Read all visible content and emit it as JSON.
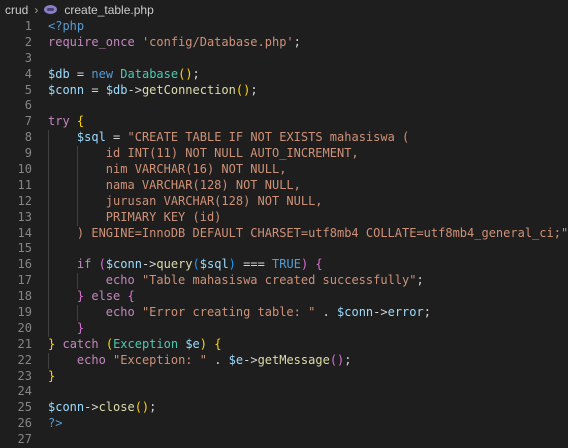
{
  "breadcrumb": {
    "folder": "crud",
    "file": "create_table.php"
  },
  "lines": [
    {
      "n": "1",
      "tokens": [
        [
          "tag",
          "<?php"
        ]
      ]
    },
    {
      "n": "2",
      "tokens": [
        [
          "kw",
          "require_once"
        ],
        [
          "plain",
          " "
        ],
        [
          "str",
          "'config/Database.php'"
        ],
        [
          "plain",
          ";"
        ]
      ]
    },
    {
      "n": "3",
      "tokens": []
    },
    {
      "n": "4",
      "tokens": [
        [
          "var",
          "$db"
        ],
        [
          "plain",
          " = "
        ],
        [
          "sqlkw",
          "new"
        ],
        [
          "plain",
          " "
        ],
        [
          "cls",
          "Database"
        ],
        [
          "p1",
          "()"
        ],
        [
          "plain",
          ";"
        ]
      ]
    },
    {
      "n": "5",
      "tokens": [
        [
          "var",
          "$conn"
        ],
        [
          "plain",
          " = "
        ],
        [
          "var",
          "$db"
        ],
        [
          "plain",
          "->"
        ],
        [
          "fn",
          "getConnection"
        ],
        [
          "p1",
          "()"
        ],
        [
          "plain",
          ";"
        ]
      ]
    },
    {
      "n": "6",
      "tokens": []
    },
    {
      "n": "7",
      "tokens": [
        [
          "kw",
          "try"
        ],
        [
          "plain",
          " "
        ],
        [
          "p1",
          "{"
        ]
      ]
    },
    {
      "n": "8",
      "tokens": [
        [
          "plain",
          "    "
        ],
        [
          "var",
          "$sql"
        ],
        [
          "plain",
          " = "
        ],
        [
          "str",
          "\"CREATE TABLE IF NOT EXISTS mahasiswa ("
        ]
      ]
    },
    {
      "n": "9",
      "tokens": [
        [
          "str",
          "        id INT(11) NOT NULL AUTO_INCREMENT,"
        ]
      ]
    },
    {
      "n": "10",
      "tokens": [
        [
          "str",
          "        nim VARCHAR(16) NOT NULL,"
        ]
      ]
    },
    {
      "n": "11",
      "tokens": [
        [
          "str",
          "        nama VARCHAR(128) NOT NULL,"
        ]
      ]
    },
    {
      "n": "12",
      "tokens": [
        [
          "str",
          "        jurusan VARCHAR(128) NOT NULL,"
        ]
      ]
    },
    {
      "n": "13",
      "tokens": [
        [
          "str",
          "        PRIMARY KEY (id)"
        ]
      ]
    },
    {
      "n": "14",
      "tokens": [
        [
          "str",
          "    ) ENGINE=InnoDB DEFAULT CHARSET=utf8mb4 COLLATE=utf8mb4_general_ci;\""
        ],
        [
          "plain",
          ";"
        ]
      ]
    },
    {
      "n": "15",
      "tokens": []
    },
    {
      "n": "16",
      "tokens": [
        [
          "plain",
          "    "
        ],
        [
          "kw",
          "if"
        ],
        [
          "plain",
          " "
        ],
        [
          "p2",
          "("
        ],
        [
          "var",
          "$conn"
        ],
        [
          "plain",
          "->"
        ],
        [
          "fn",
          "query"
        ],
        [
          "p3",
          "("
        ],
        [
          "var",
          "$sql"
        ],
        [
          "p3",
          ")"
        ],
        [
          "plain",
          " === "
        ],
        [
          "sqlkw",
          "TRUE"
        ],
        [
          "p2",
          ")"
        ],
        [
          "plain",
          " "
        ],
        [
          "p2",
          "{"
        ]
      ]
    },
    {
      "n": "17",
      "tokens": [
        [
          "plain",
          "        "
        ],
        [
          "kw",
          "echo"
        ],
        [
          "plain",
          " "
        ],
        [
          "str",
          "\"Table mahasiswa created successfully\""
        ],
        [
          "plain",
          ";"
        ]
      ]
    },
    {
      "n": "18",
      "tokens": [
        [
          "plain",
          "    "
        ],
        [
          "p2",
          "}"
        ],
        [
          "plain",
          " "
        ],
        [
          "kw",
          "else"
        ],
        [
          "plain",
          " "
        ],
        [
          "p2",
          "{"
        ]
      ]
    },
    {
      "n": "19",
      "tokens": [
        [
          "plain",
          "        "
        ],
        [
          "kw",
          "echo"
        ],
        [
          "plain",
          " "
        ],
        [
          "str",
          "\"Error creating table: \""
        ],
        [
          "plain",
          " . "
        ],
        [
          "var",
          "$conn"
        ],
        [
          "plain",
          "->"
        ],
        [
          "var",
          "error"
        ],
        [
          "plain",
          ";"
        ]
      ]
    },
    {
      "n": "20",
      "tokens": [
        [
          "plain",
          "    "
        ],
        [
          "p2",
          "}"
        ]
      ]
    },
    {
      "n": "21",
      "tokens": [
        [
          "p1",
          "}"
        ],
        [
          "plain",
          " "
        ],
        [
          "kw",
          "catch"
        ],
        [
          "plain",
          " "
        ],
        [
          "p1",
          "("
        ],
        [
          "cls",
          "Exception"
        ],
        [
          "plain",
          " "
        ],
        [
          "var",
          "$e"
        ],
        [
          "p1",
          ")"
        ],
        [
          "plain",
          " "
        ],
        [
          "p1",
          "{"
        ]
      ]
    },
    {
      "n": "22",
      "tokens": [
        [
          "plain",
          "    "
        ],
        [
          "kw",
          "echo"
        ],
        [
          "plain",
          " "
        ],
        [
          "str",
          "\"Exception: \""
        ],
        [
          "plain",
          " . "
        ],
        [
          "var",
          "$e"
        ],
        [
          "plain",
          "->"
        ],
        [
          "fn",
          "getMessage"
        ],
        [
          "p2",
          "()"
        ],
        [
          "plain",
          ";"
        ]
      ]
    },
    {
      "n": "23",
      "tokens": [
        [
          "p1",
          "}"
        ]
      ]
    },
    {
      "n": "24",
      "tokens": []
    },
    {
      "n": "25",
      "tokens": [
        [
          "var",
          "$conn"
        ],
        [
          "plain",
          "->"
        ],
        [
          "fn",
          "close"
        ],
        [
          "p1",
          "()"
        ],
        [
          "plain",
          ";"
        ]
      ]
    },
    {
      "n": "26",
      "tokens": [
        [
          "tag",
          "?>"
        ]
      ]
    },
    {
      "n": "27",
      "tokens": []
    }
  ],
  "colors": {
    "background": "#1e1e1e",
    "line_number": "#858585",
    "keyword": "#c586c0",
    "string": "#ce9178",
    "variable": "#9cdcfe",
    "function": "#dcdcaa",
    "class": "#4ec9b0",
    "tag": "#569cd6"
  },
  "icons": {
    "file_type": "php-file-icon",
    "separator": "chevron-right-icon"
  }
}
